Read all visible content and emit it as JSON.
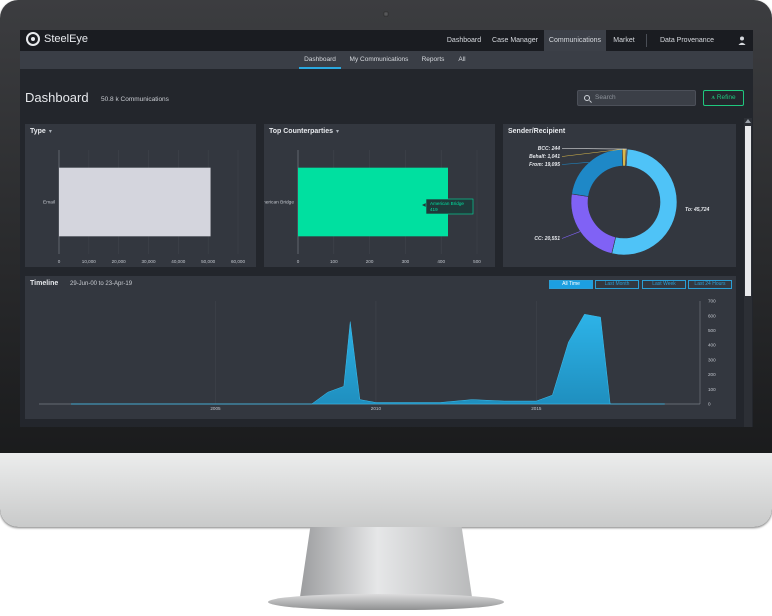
{
  "app": {
    "brand": "SteelEye"
  },
  "topnav": {
    "items": [
      {
        "label": "Dashboard"
      },
      {
        "label": "Case Manager"
      },
      {
        "label": "Communications"
      },
      {
        "label": "Market"
      },
      {
        "label": "Data Provenance"
      }
    ],
    "active": "Communications",
    "user_icon": "user-icon"
  },
  "subnav": {
    "items": [
      {
        "label": "Dashboard"
      },
      {
        "label": "My Communications"
      },
      {
        "label": "Reports"
      },
      {
        "label": "All"
      }
    ],
    "active": "Dashboard"
  },
  "page": {
    "title": "Dashboard",
    "count": "50.8 k Communications",
    "search_placeholder": "Search",
    "refine_label": "Refine"
  },
  "colors": {
    "accent": "#2aa8e0",
    "refine": "#1fc77e",
    "type_bar": "#d4d5dd",
    "counterparty_bar": "#00e0a0",
    "timeline": "#1f8fbf"
  },
  "chart_data": [
    {
      "type": "bar",
      "orientation": "horizontal",
      "title": "Type",
      "categories": [
        "Email"
      ],
      "values": [
        50800
      ],
      "xlim": [
        0,
        60000
      ],
      "xticks": [
        "0",
        "10,000",
        "20,000",
        "30,000",
        "40,000",
        "50,000",
        "60,000"
      ]
    },
    {
      "type": "bar",
      "orientation": "horizontal",
      "title": "Top Counterparties",
      "categories": [
        "American Bridge"
      ],
      "values": [
        419
      ],
      "xlim": [
        0,
        500
      ],
      "xticks": [
        "0",
        "100",
        "200",
        "300",
        "400",
        "500"
      ],
      "tooltip": {
        "label": "American Bridge",
        "value": "419"
      }
    },
    {
      "type": "pie",
      "title": "Sender/Recipient",
      "donut": true,
      "labels": [
        "To",
        "CC",
        "From",
        "Behalf",
        "BCC"
      ],
      "values": [
        45724,
        20551,
        19095,
        1041,
        244
      ],
      "display": [
        "To: 45,724",
        "CC: 20,551",
        "From: 19,095",
        "Behalf: 1,041",
        "BCC: 244"
      ],
      "colors": [
        "#4fc3f7",
        "#8062f5",
        "#1e88c7",
        "#d9b84a",
        "#f5f5f5"
      ]
    },
    {
      "type": "area",
      "title": "Timeline",
      "subtitle": "29-Jun-00 to 23-Apr-19",
      "x": [
        2000.5,
        2008.0,
        2008.5,
        2009.0,
        2009.2,
        2009.5,
        2010.0,
        2012.0,
        2013.0,
        2014.0,
        2015.0,
        2015.5,
        2016.0,
        2016.5,
        2017.0,
        2017.3,
        2019.0
      ],
      "y": [
        0,
        0,
        80,
        120,
        560,
        30,
        10,
        10,
        30,
        20,
        20,
        60,
        420,
        610,
        590,
        0,
        0
      ],
      "xticks": [
        "2005",
        "2010",
        "2015"
      ],
      "xtick_values": [
        2005,
        2010,
        2015
      ],
      "ylim": [
        0,
        700
      ],
      "yticks": [
        "0",
        "100",
        "200",
        "300",
        "400",
        "500",
        "600",
        "700"
      ],
      "range_buttons": [
        "All Time",
        "Last Month",
        "Last Week",
        "Last 24 Hours"
      ],
      "active_range": "All Time"
    }
  ]
}
